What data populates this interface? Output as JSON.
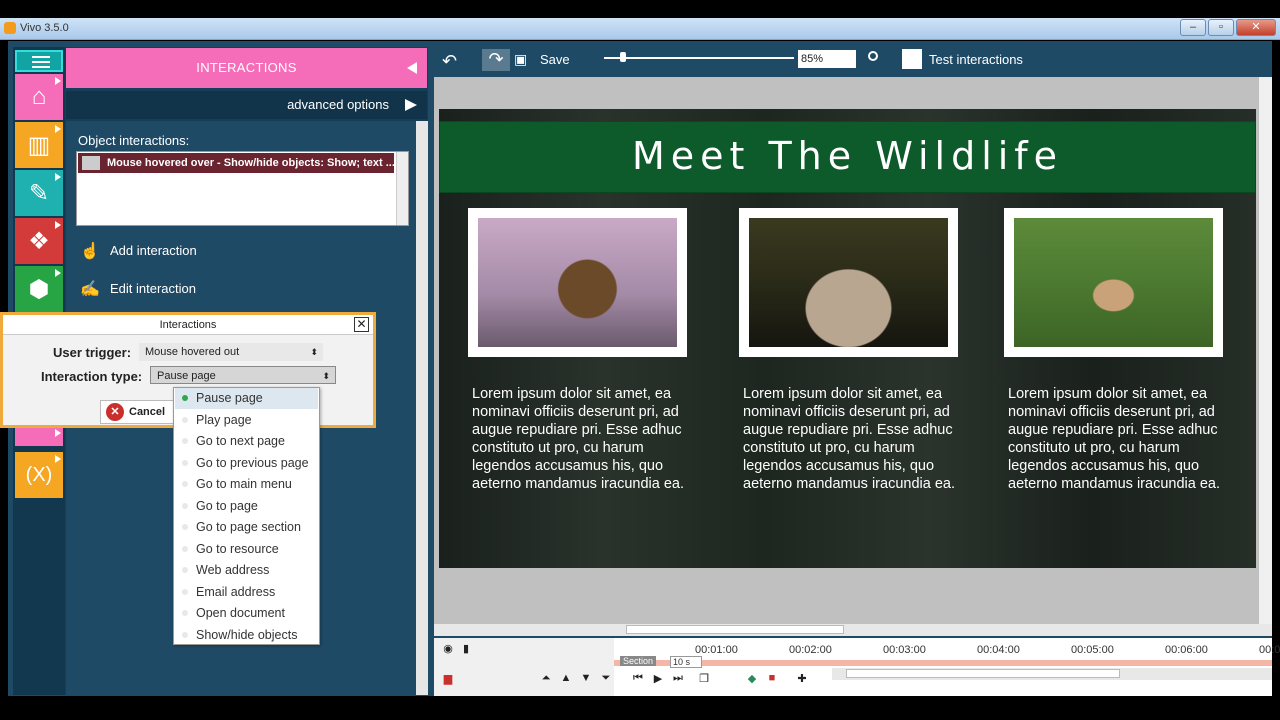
{
  "window": {
    "title": "Vivo 3.5.0"
  },
  "rail": {
    "buttons": [
      {
        "icon": "home-icon",
        "color": "#f56cb8"
      },
      {
        "icon": "library-icon",
        "color": "#f5a623"
      },
      {
        "icon": "tools-icon",
        "color": "#1fb0b0"
      },
      {
        "icon": "cubes-icon",
        "color": "#d33b3b"
      },
      {
        "icon": "package-icon",
        "color": "#27a444"
      },
      {
        "icon": "variables-icon",
        "color": "#f5a623",
        "label": "(X)"
      }
    ]
  },
  "panel": {
    "header": "INTERACTIONS",
    "advanced": "advanced options",
    "object_interactions_label": "Object interactions:",
    "interaction_item": "Mouse hovered over - Show/hide objects: Show; text ...",
    "add_interaction": "Add interaction",
    "edit_interaction": "Edit interaction"
  },
  "dialog": {
    "title": "Interactions",
    "user_trigger_label": "User trigger:",
    "user_trigger_value": "Mouse hovered out",
    "interaction_type_label": "Interaction type:",
    "interaction_type_value": "Pause page",
    "cancel": "Cancel"
  },
  "dropdown": {
    "options": [
      "Pause page",
      "Play page",
      "Go to next page",
      "Go to previous page",
      "Go to main menu",
      "Go to page",
      "Go to page section",
      "Go to resource",
      "Web address",
      "Email address",
      "Open document",
      "Show/hide objects"
    ],
    "selected": "Pause page"
  },
  "toolbar": {
    "save": "Save",
    "zoom": "85%",
    "test_interactions": "Test interactions"
  },
  "page": {
    "title": "Meet The Wildlife",
    "blurb": "Lorem ipsum dolor sit amet, ea nominavi officiis deserunt pri, ad augue repudiare pri. Esse adhuc constituto ut pro, cu harum legendos accusamus his, quo aeterno mandamus iracundia ea.",
    "photos": [
      "thistle-photo",
      "mushroom-photo",
      "deer-photo"
    ]
  },
  "timeline": {
    "ticks": [
      "00:01:00",
      "00:02:00",
      "00:03:00",
      "00:04:00",
      "00:05:00",
      "00:06:00",
      "00:0"
    ],
    "section": "Section",
    "duration": "10 s"
  }
}
